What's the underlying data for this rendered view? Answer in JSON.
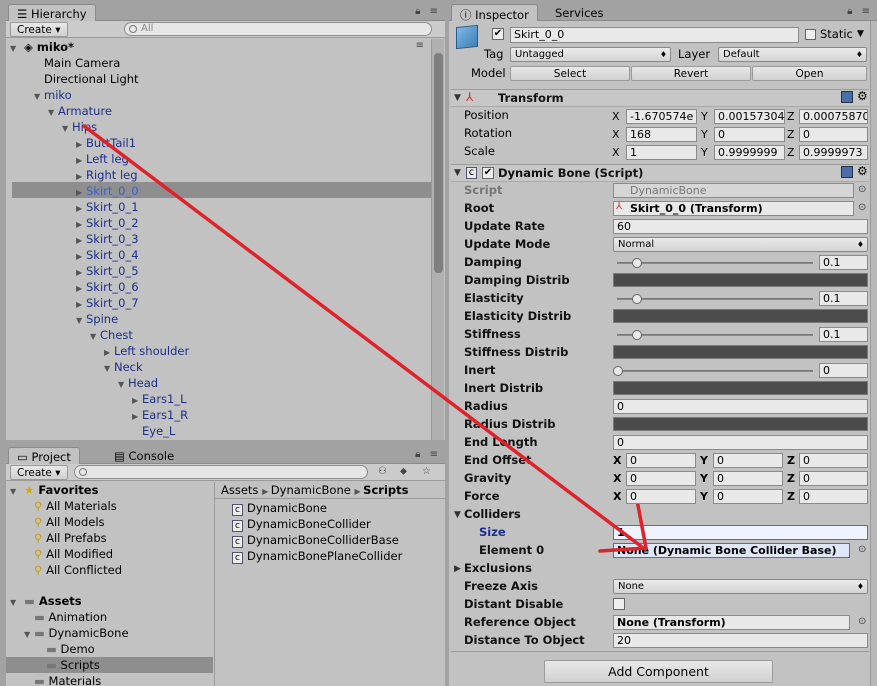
{
  "hierarchy": {
    "tab": "Hierarchy",
    "create": "Create",
    "search_placeholder": "All",
    "scene": "miko*",
    "rows": [
      {
        "label": "Main Camera",
        "indent": 1,
        "tri": "",
        "blue": false
      },
      {
        "label": "Directional Light",
        "indent": 1,
        "tri": "",
        "blue": false
      },
      {
        "label": "miko",
        "indent": 1,
        "tri": "down",
        "blue": true
      },
      {
        "label": "Armature",
        "indent": 2,
        "tri": "down",
        "blue": true
      },
      {
        "label": "Hips",
        "indent": 3,
        "tri": "down",
        "blue": true
      },
      {
        "label": "ButtTail1",
        "indent": 4,
        "tri": "right",
        "blue": true
      },
      {
        "label": "Left leg",
        "indent": 4,
        "tri": "right",
        "blue": true
      },
      {
        "label": "Right leg",
        "indent": 4,
        "tri": "right",
        "blue": true
      },
      {
        "label": "Skirt_0_0",
        "indent": 4,
        "tri": "right",
        "blue": true
      },
      {
        "label": "Skirt_0_1",
        "indent": 4,
        "tri": "right",
        "blue": true
      },
      {
        "label": "Skirt_0_2",
        "indent": 4,
        "tri": "right",
        "blue": true
      },
      {
        "label": "Skirt_0_3",
        "indent": 4,
        "tri": "right",
        "blue": true
      },
      {
        "label": "Skirt_0_4",
        "indent": 4,
        "tri": "right",
        "blue": true
      },
      {
        "label": "Skirt_0_5",
        "indent": 4,
        "tri": "right",
        "blue": true
      },
      {
        "label": "Skirt_0_6",
        "indent": 4,
        "tri": "right",
        "blue": true
      },
      {
        "label": "Skirt_0_7",
        "indent": 4,
        "tri": "right",
        "blue": true
      },
      {
        "label": "Spine",
        "indent": 4,
        "tri": "down",
        "blue": true
      },
      {
        "label": "Chest",
        "indent": 5,
        "tri": "down",
        "blue": true
      },
      {
        "label": "Left shoulder",
        "indent": 6,
        "tri": "right",
        "blue": true
      },
      {
        "label": "Neck",
        "indent": 6,
        "tri": "down",
        "blue": true
      },
      {
        "label": "Head",
        "indent": 7,
        "tri": "down",
        "blue": true
      },
      {
        "label": "Ears1_L",
        "indent": 8,
        "tri": "right",
        "blue": true
      },
      {
        "label": "Ears1_R",
        "indent": 8,
        "tri": "right",
        "blue": true
      },
      {
        "label": "Eye_L",
        "indent": 8,
        "tri": "",
        "blue": true
      }
    ]
  },
  "project": {
    "tab_project": "Project",
    "tab_console": "Console",
    "create": "Create",
    "favorites_title": "Favorites",
    "favorites": [
      "All Materials",
      "All Models",
      "All Prefabs",
      "All Modified",
      "All Conflicted"
    ],
    "assets_title": "Assets",
    "assets": [
      {
        "label": "Animation",
        "indent": 1
      },
      {
        "label": "DynamicBone",
        "indent": 1
      },
      {
        "label": "Demo",
        "indent": 2
      },
      {
        "label": "Scripts",
        "indent": 2
      },
      {
        "label": "Materials",
        "indent": 1
      }
    ],
    "breadcrumb": [
      "Assets",
      "DynamicBone",
      "Scripts"
    ],
    "files": [
      "DynamicBone",
      "DynamicBoneCollider",
      "DynamicBoneColliderBase",
      "DynamicBonePlaneCollider"
    ]
  },
  "inspector": {
    "tab_inspector": "Inspector",
    "tab_services": "Services",
    "object_name": "Skirt_0_0",
    "static_label": "Static",
    "tag_label": "Tag",
    "tag_value": "Untagged",
    "layer_label": "Layer",
    "layer_value": "Default",
    "model_label": "Model",
    "model_buttons": [
      "Select",
      "Revert",
      "Open"
    ],
    "transform": {
      "title": "Transform",
      "position_label": "Position",
      "rotation_label": "Rotation",
      "scale_label": "Scale",
      "position": [
        "-1.670574e",
        "0.00157304",
        "0.00075870"
      ],
      "rotation": [
        "168",
        "0",
        "0"
      ],
      "scale": [
        "1",
        "0.9999999",
        "0.9999973"
      ],
      "axes": [
        "X",
        "Y",
        "Z"
      ]
    },
    "dynamic_bone": {
      "title": "Dynamic Bone (Script)",
      "script_label": "Script",
      "script_value": "DynamicBone",
      "root_label": "Root",
      "root_value": "Skirt_0_0 (Transform)",
      "update_rate_label": "Update Rate",
      "update_rate": "60",
      "update_mode_label": "Update Mode",
      "update_mode": "Normal",
      "damping_label": "Damping",
      "damping": "0.1",
      "damping_distrib_label": "Damping Distrib",
      "elasticity_label": "Elasticity",
      "elasticity": "0.1",
      "elasticity_distrib_label": "Elasticity Distrib",
      "stiffness_label": "Stiffness",
      "stiffness": "0.1",
      "stiffness_distrib_label": "Stiffness Distrib",
      "inert_label": "Inert",
      "inert": "0",
      "inert_distrib_label": "Inert Distrib",
      "radius_label": "Radius",
      "radius": "0",
      "radius_distrib_label": "Radius Distrib",
      "end_length_label": "End Length",
      "end_length": "0",
      "end_offset_label": "End Offset",
      "end_offset": [
        "0",
        "0",
        "0"
      ],
      "gravity_label": "Gravity",
      "gravity": [
        "0",
        "0",
        "0"
      ],
      "force_label": "Force",
      "force": [
        "0",
        "0",
        "0"
      ],
      "colliders_label": "Colliders",
      "size_label": "Size",
      "size": "1",
      "element0_label": "Element 0",
      "element0": "None (Dynamic Bone Collider Base)",
      "exclusions_label": "Exclusions",
      "freeze_axis_label": "Freeze Axis",
      "freeze_axis": "None",
      "distant_disable_label": "Distant Disable",
      "reference_object_label": "Reference Object",
      "reference_object": "None (Transform)",
      "distance_label": "Distance To Object",
      "distance": "20"
    },
    "add_component": "Add Component"
  },
  "annotation_color": "#e0232b"
}
